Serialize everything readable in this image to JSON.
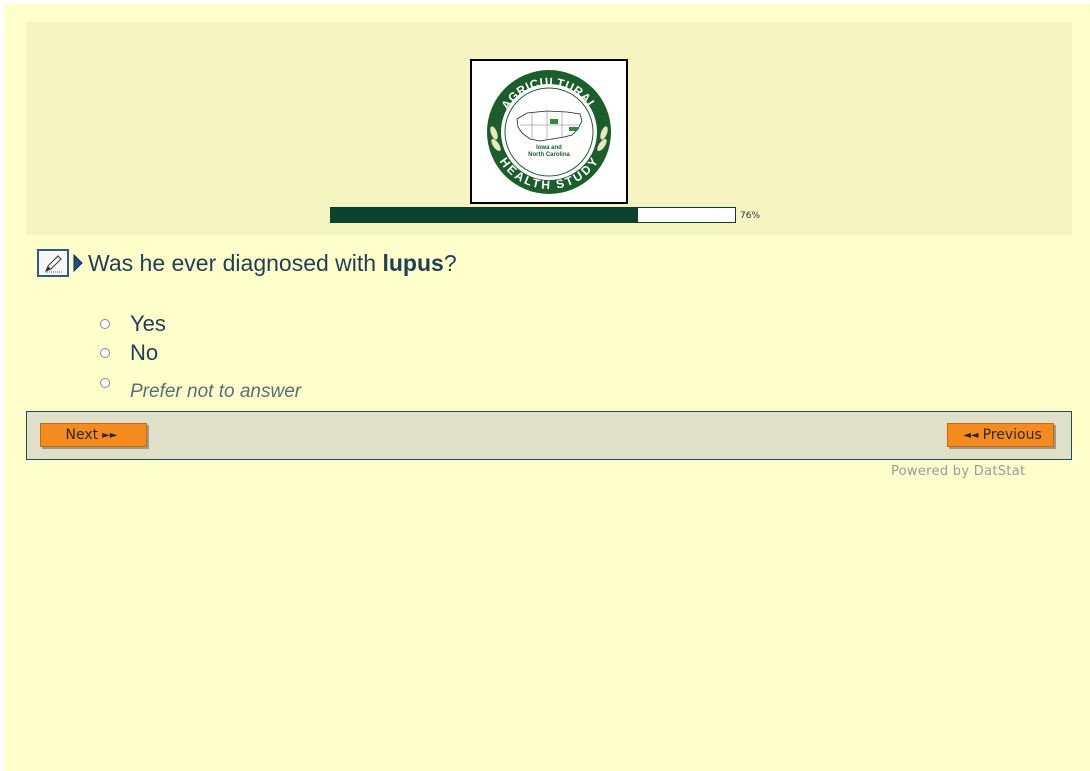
{
  "logo": {
    "top_text": "AGRICULTURAL",
    "bottom_text": "HEALTH STUDY",
    "center_text_1": "Iowa and",
    "center_text_2": "North Carolina",
    "ring_color": "#1b5e2c"
  },
  "progress": {
    "percent_label": "76%",
    "value": 0.76,
    "fill_color": "#0b4330"
  },
  "question": {
    "prefix": "Was he ever diagnosed with ",
    "emphasis": "lupus",
    "suffix": "?"
  },
  "options": [
    {
      "label": "Yes"
    },
    {
      "label": "No"
    },
    {
      "label": "Prefer not to answer"
    }
  ],
  "nav": {
    "next_label": "Next",
    "previous_label": "Previous",
    "button_color": "#f58a1f"
  },
  "footer": {
    "powered_by": "Powered by DatStat"
  }
}
